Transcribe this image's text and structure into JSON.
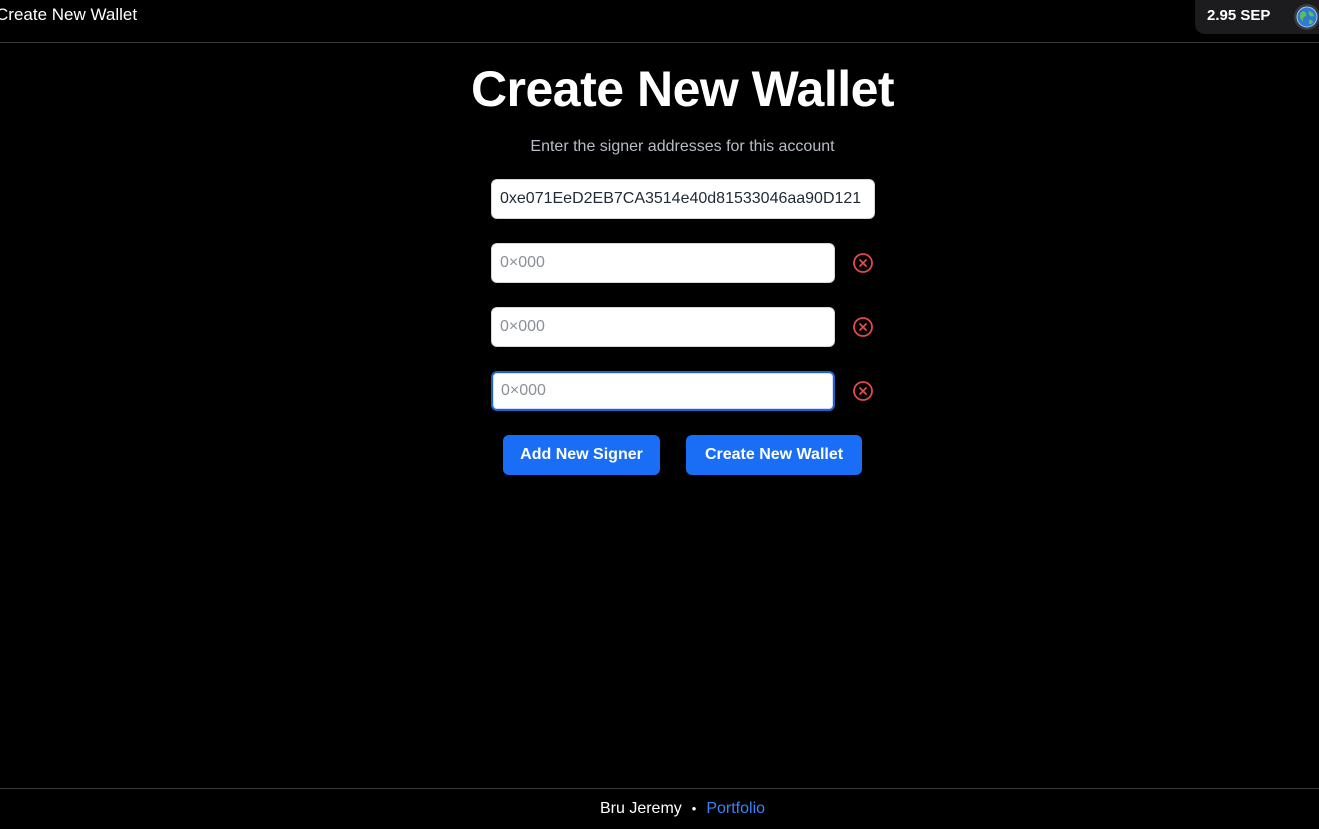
{
  "header": {
    "title": "Create New Wallet",
    "balance": "2.95 SEP",
    "network_icon": "globe-icon"
  },
  "main": {
    "title": "Create New Wallet",
    "subtitle": "Enter the signer addresses for this account",
    "signers": [
      {
        "value": "0xe071EeD2EB7CA3514e40d81533046aa90D121",
        "placeholder": "0×000"
      },
      {
        "value": "",
        "placeholder": "0×000"
      },
      {
        "value": "",
        "placeholder": "0×000"
      },
      {
        "value": "",
        "placeholder": "0×000"
      }
    ],
    "remove_icon": "remove-circle-icon",
    "add_signer_label": "Add New Signer",
    "create_wallet_label": "Create New Wallet"
  },
  "footer": {
    "name": "Bru Jeremy",
    "separator": "•",
    "link_label": "Portfolio"
  },
  "colors": {
    "background": "#000000",
    "accent": "#1a6ef5",
    "remove": "#e5484d",
    "link": "#3b82f6"
  }
}
